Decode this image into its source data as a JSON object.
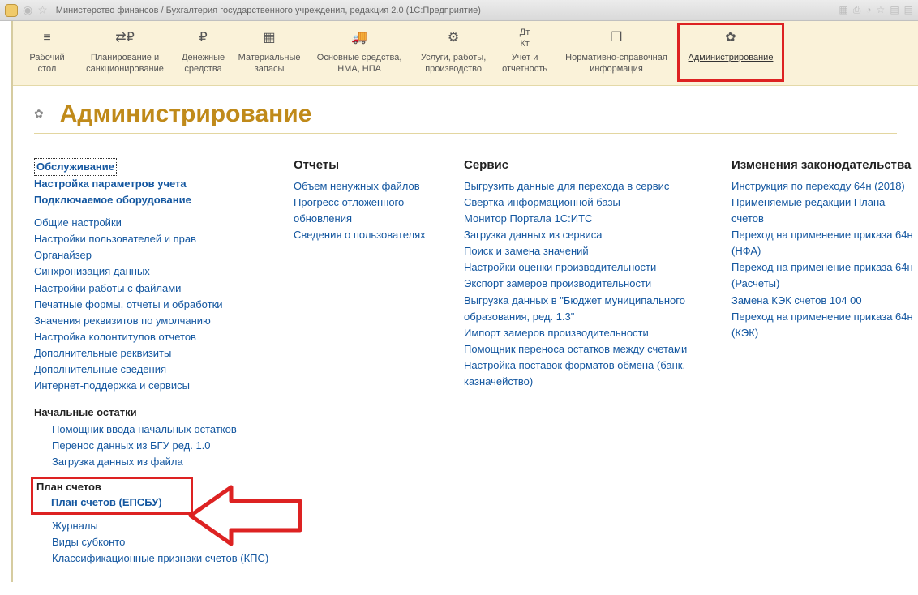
{
  "window": {
    "title": "Министерство финансов / Бухгалтерия государственного учреждения, редакция 2.0  (1С:Предприятие)"
  },
  "toolbar": {
    "items": [
      {
        "label": "Рабочий\nстол"
      },
      {
        "label": "Планирование и\nсанкционирование"
      },
      {
        "label": "Денежные\nсредства"
      },
      {
        "label": "Материальные\nзапасы"
      },
      {
        "label": "Основные средства,\nНМА, НПА"
      },
      {
        "label": "Услуги, работы,\nпроизводство"
      },
      {
        "label": "Учет и\nотчетность"
      },
      {
        "label": "Нормативно-справочная\nинформация"
      },
      {
        "label": "Администрирование"
      }
    ]
  },
  "page": {
    "title": "Администрирование"
  },
  "col1": {
    "top_bold": [
      "Обслуживание",
      "Настройка параметров учета",
      "Подключаемое оборудование"
    ],
    "items": [
      "Общие настройки",
      "Настройки пользователей и прав",
      "Органайзер",
      "Синхронизация данных",
      "Настройки работы с файлами",
      "Печатные формы, отчеты и обработки",
      "Значения реквизитов по умолчанию",
      "Настройка колонтитулов отчетов",
      "Дополнительные реквизиты",
      "Дополнительные сведения",
      "Интернет-поддержка и сервисы"
    ],
    "section2": "Начальные остатки",
    "items2": [
      "Помощник ввода начальных остатков",
      "Перенос данных из БГУ ред. 1.0",
      "Загрузка данных из файла"
    ],
    "plan_header": "План счетов",
    "plan_item": "План счетов (ЕПСБУ)",
    "items3": [
      "Журналы",
      "Виды субконто",
      "Классификационные признаки счетов (КПС)"
    ]
  },
  "col2": {
    "title": "Отчеты",
    "items": [
      "Объем ненужных файлов",
      "Прогресс отложенного обновления",
      "Сведения о пользователях"
    ]
  },
  "col3": {
    "title": "Сервис",
    "items": [
      "Выгрузить данные для перехода в сервис",
      "Свертка информационной базы",
      "Монитор Портала 1С:ИТС",
      "Загрузка данных из сервиса",
      "Поиск и замена значений",
      "Настройки оценки производительности",
      "Экспорт замеров производительности",
      "Выгрузка данных в \"Бюджет муниципального образования, ред. 1.3\"",
      "Импорт замеров производительности",
      "Помощник переноса остатков между счетами",
      "Настройка поставок форматов обмена (банк, казначейство)"
    ]
  },
  "col4": {
    "title": "Изменения законодательства",
    "items": [
      "Инструкция по переходу 64н (2018)",
      "Применяемые редакции Плана счетов",
      "Переход на применение приказа 64н (НФА)",
      "Переход на применение приказа 64н (Расчеты)",
      "Замена КЭК счетов 104 00",
      "Переход на применение приказа 64н (КЭК)"
    ]
  }
}
